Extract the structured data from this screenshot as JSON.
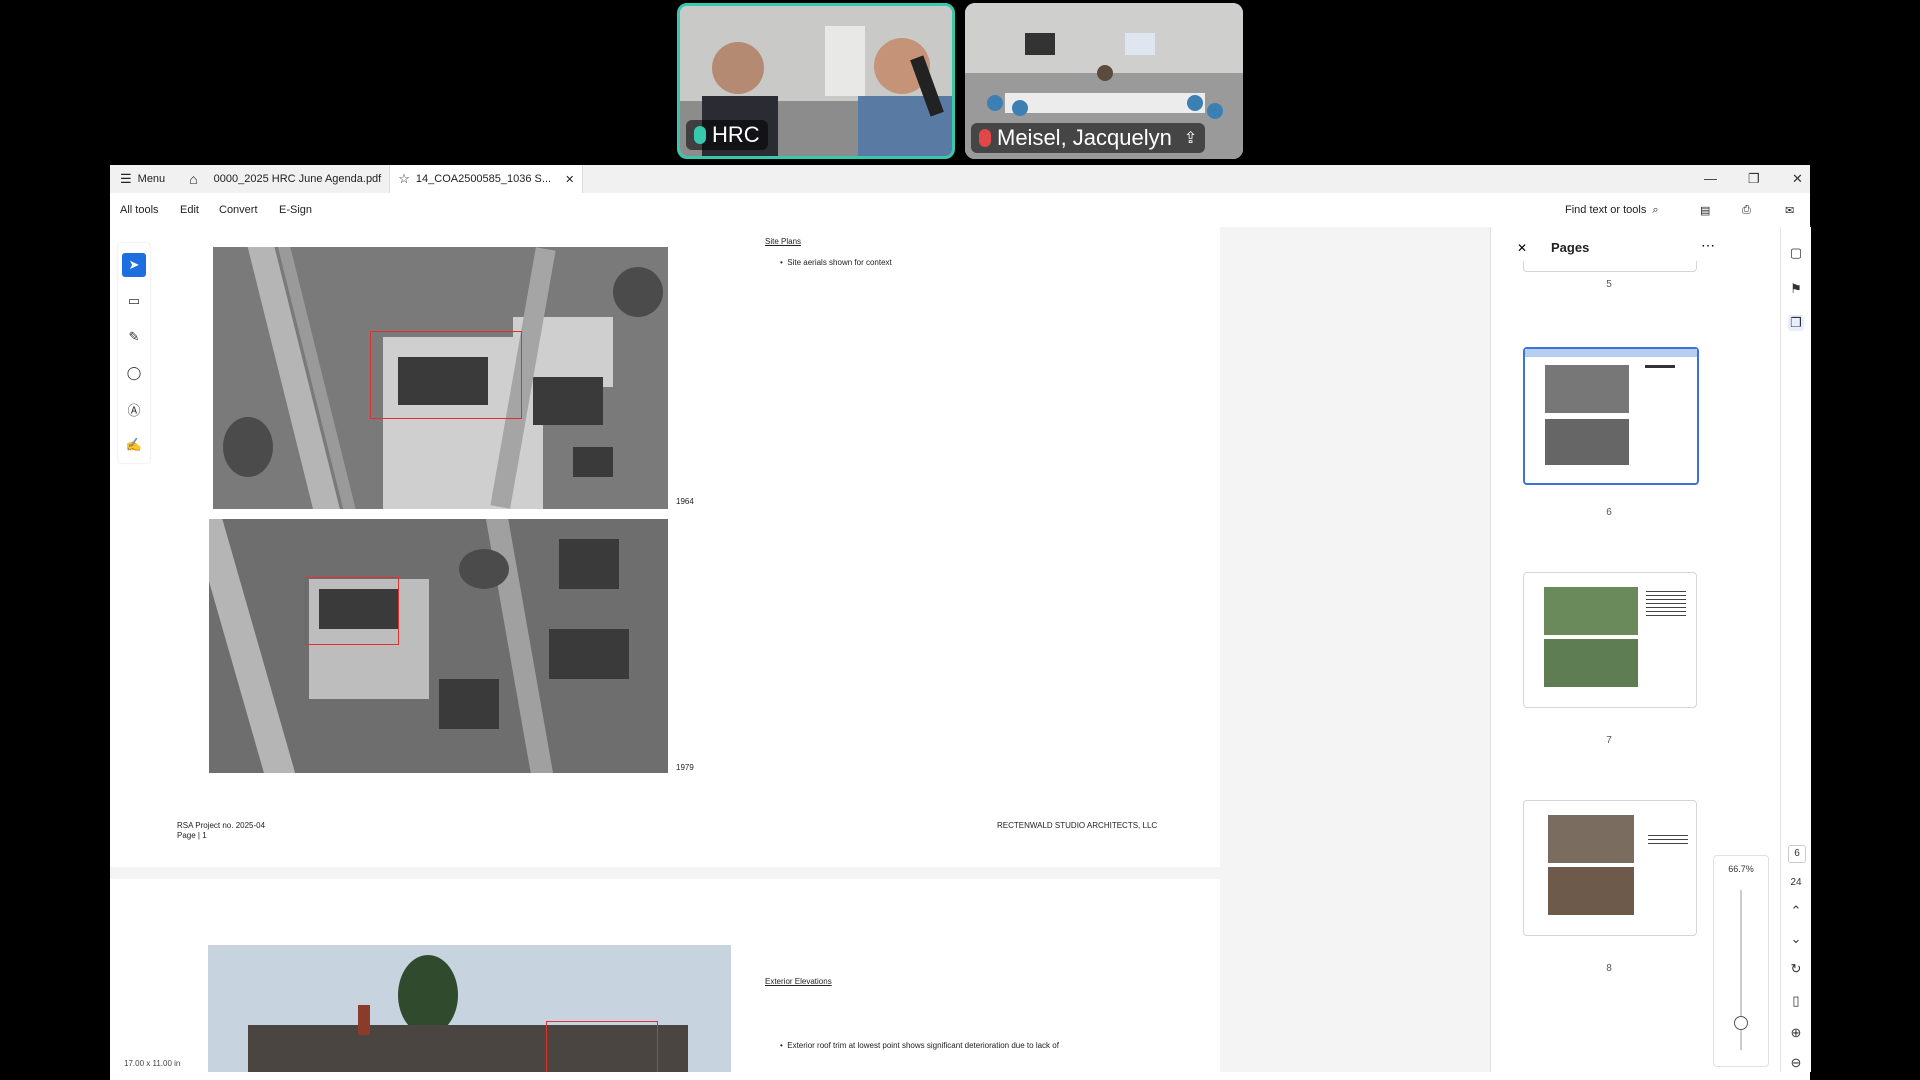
{
  "video": {
    "tiles": [
      {
        "name": "HRC",
        "mic": "mic-on-icon"
      },
      {
        "name": "Meisel, Jacquelyn",
        "mic": "mic-muted-icon"
      }
    ],
    "accent": "#36c9ad"
  },
  "app": {
    "menu_label": "Menu",
    "tabs": [
      {
        "label": "0000_2025 HRC June Agenda.pdf"
      },
      {
        "label": "14_COA2500585_1036 S..."
      }
    ],
    "toolbar": {
      "items": [
        "All tools",
        "Edit",
        "Convert",
        "E-Sign"
      ],
      "search_label": "Find text or tools"
    },
    "left_tools": [
      "select-icon",
      "comment-icon",
      "pen-icon",
      "lasso-icon",
      "text-select-icon",
      "sign-icon"
    ]
  },
  "document": {
    "page1": {
      "section_title": "Site Plans",
      "bullet": "Site aerials shown for context",
      "year_top": "1964",
      "year_bottom": "1979",
      "footer_left_line1": "RSA Project no. 2025-04",
      "footer_left_line2": "Page | 1",
      "footer_right": "RECTENWALD STUDIO ARCHITECTS, LLC"
    },
    "page2": {
      "section_title": "Exterior Elevations",
      "bullet": "Exterior roof trim at lowest point shows significant deterioration due to lack of"
    },
    "page_size": "17.00 x 11.00 in"
  },
  "pages_panel": {
    "title": "Pages",
    "thumbnails": [
      {
        "number": "5"
      },
      {
        "number": "6",
        "selected": true
      },
      {
        "number": "7"
      },
      {
        "number": "8"
      }
    ]
  },
  "zoom": {
    "level": "66.7%",
    "current_page": "6",
    "total_pages": "24"
  }
}
